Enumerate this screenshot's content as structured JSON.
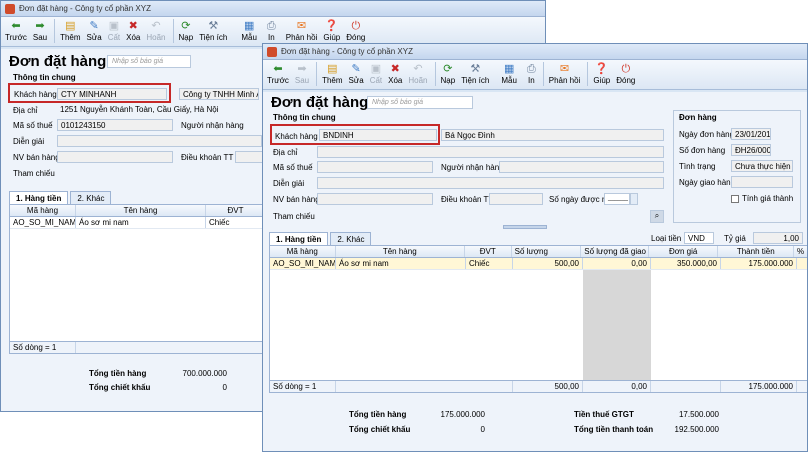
{
  "toolbar": {
    "back": "Trước",
    "next": "Sau",
    "add": "Thêm",
    "edit": "Sửa",
    "save": "Cất",
    "delete": "Xóa",
    "undo": "Hoãn",
    "load": "Nạp",
    "utility": "Tiện ích",
    "template": "Mẫu",
    "print": "In",
    "feedback": "Phản hồi",
    "help": "Giúp",
    "close": "Đóng"
  },
  "back_window": {
    "title": "Đơn đặt hàng - Công ty cổ phần XYZ",
    "heading": "Đơn đặt hàng",
    "search_placeholder": "Nhập số báo giá",
    "section_general": "Thông tin chung",
    "labels": {
      "customer": "Khách hàng",
      "address": "Địa chỉ",
      "tax_code": "Mã số thuế",
      "receiver": "Người nhận hàng",
      "explain": "Diễn giải",
      "salesperson": "NV bán hàng",
      "terms": "Điều khoản TT",
      "reference": "Tham chiếu"
    },
    "values": {
      "customer_code": "CTY MINHANH",
      "customer_name": "Công ty TNHH Minh Anh",
      "address": "1251 Nguyễn Khánh Toàn, Cầu Giấy, Hà Nội",
      "tax_code": "0101243150"
    },
    "tabs": [
      "1. Hàng tiền",
      "2. Khác"
    ],
    "grid_headers": [
      "Mã hàng",
      "Tên hàng",
      "ĐVT"
    ],
    "rows": [
      [
        "AO_SO_MI_NAM",
        "Áo sơ mi nam",
        "Chiếc"
      ]
    ],
    "row_count": "Số dòng = 1",
    "total_goods_label": "Tổng tiền hàng",
    "total_goods_value": "700.000.000",
    "total_discount_label": "Tổng chiết khấu",
    "total_discount_value": "0"
  },
  "front_window": {
    "title": "Đơn đặt hàng - Công ty cổ phần XYZ",
    "heading": "Đơn đặt hàng",
    "search_placeholder": "Nhập số báo giá",
    "section_general": "Thông tin chung",
    "section_order": "Đơn hàng",
    "labels": {
      "customer": "Khách hàng",
      "address": "Địa chỉ",
      "tax_code": "Mã số thuế",
      "receiver": "Người nhận hàng",
      "explain": "Diễn giải",
      "salesperson": "NV bán hàng",
      "terms": "Điều khoản TT",
      "credit_days": "Số ngày được nợ",
      "reference": "Tham chiếu",
      "order_date": "Ngày đơn hàng",
      "order_no": "Số đơn hàng",
      "status": "Tình trạng",
      "delivery_date": "Ngày giao hàng",
      "calc_price": "Tính giá thành",
      "currency": "Loại tiền",
      "rate": "Tỷ giá"
    },
    "values": {
      "customer_code": "BNDINH",
      "customer_name": "Bá Ngọc Đình",
      "order_date": "23/01/2016",
      "order_no": "ĐH26/0002",
      "status": "Chưa thực hiện",
      "currency": "VND",
      "rate": "1,00",
      "credit_days": "______"
    },
    "tabs": [
      "1. Hàng tiền",
      "2. Khác"
    ],
    "grid_headers": [
      "Mã hàng",
      "Tên hàng",
      "ĐVT",
      "Số lượng",
      "Số lượng đã giao",
      "Đơn giá",
      "Thành tiền",
      "%"
    ],
    "rows": [
      [
        "AO_SO_MI_NAM",
        "Áo sơ mi nam",
        "Chiếc",
        "500,00",
        "0,00",
        "350.000,00",
        "175.000.000"
      ]
    ],
    "row_count": "Số dòng = 1",
    "footer_qty": "500,00",
    "footer_delivered": "0,00",
    "footer_amount": "175.000.000",
    "totals": {
      "goods_label": "Tổng tiền hàng",
      "goods_value": "175.000.000",
      "discount_label": "Tổng chiết khấu",
      "discount_value": "0",
      "vat_label": "Tiền thuế GTGT",
      "vat_value": "17.500.000",
      "payment_label": "Tổng tiền thanh toán",
      "payment_value": "192.500.000"
    }
  },
  "colors": {
    "accent_red": "#c62828",
    "window_bg": "#d9e6f4",
    "selected_row": "#fff7d6"
  }
}
